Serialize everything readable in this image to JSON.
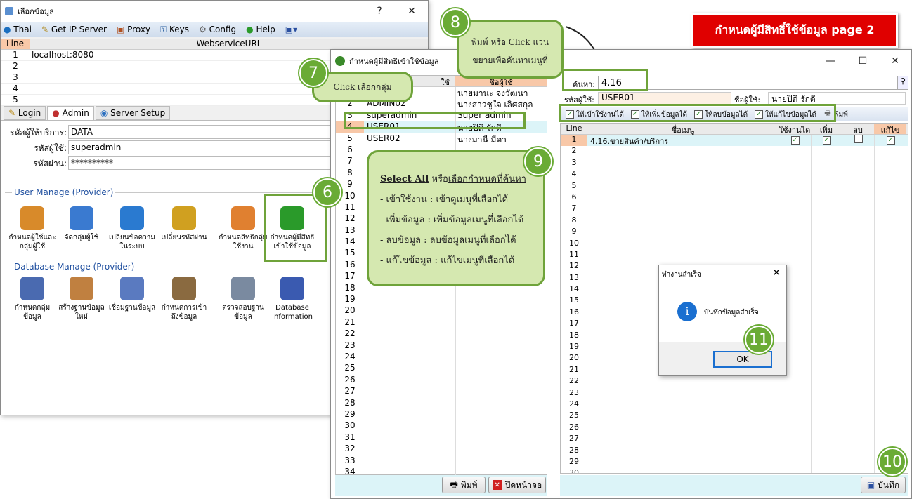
{
  "banner": {
    "text": "กำหนดผู้มีสิทธิ์ใช้ข้อมูล  page 2"
  },
  "login_window": {
    "title": "เลือกข้อมูล",
    "help_btn": "?",
    "close_btn": "✕",
    "menu": [
      "Thai",
      "Get IP Server",
      "Proxy",
      "Keys",
      "Config",
      "Help"
    ],
    "url_table": {
      "col_line": "Line",
      "col_url": "WebserviceURL",
      "rows": [
        {
          "n": "1",
          "url": "localhost:8080"
        },
        {
          "n": "2",
          "url": ""
        },
        {
          "n": "3",
          "url": ""
        },
        {
          "n": "4",
          "url": ""
        },
        {
          "n": "5",
          "url": ""
        }
      ]
    },
    "tabs": [
      "Login",
      "Admin",
      "Server Setup"
    ],
    "fields": [
      {
        "label": "รหัสผู้ให้บริการ:",
        "value": "DATA"
      },
      {
        "label": "รหัสผู้ใช้:",
        "value": "superadmin"
      },
      {
        "label": "รหัสผ่าน:",
        "value": "**********"
      }
    ],
    "user_manage_title": "User Manage (Provider)",
    "user_items": [
      "กำหนดผู้ใช้และกลุ่มผู้ใช้",
      "จัดกลุ่มผู้ใช้",
      "เปลี่ยนข้อความในระบบ",
      "เปลี่ยนรหัสผ่าน",
      "กำหนดสิทธิกลุ่มใช้งาน",
      "กำหนดผู้มีสิทธิเข้าใช้ข้อมูล"
    ],
    "db_manage_title": "Database Manage (Provider)",
    "db_items": [
      "กำหนดกลุ่มข้อมูล",
      "สร้างฐานข้อมูลใหม่",
      "เชื่อมฐานข้อมูล",
      "กำหนดการเข้าถึงข้อมูล",
      "ตรวจสอบฐานข้อมูล",
      "Database Information"
    ]
  },
  "main_window": {
    "title": "กำหนดผู้มีสิทธิเข้าใช้ข้อมูล",
    "left": {
      "header_user": "ใช้",
      "header_name": "ชื่อผู้ใช้",
      "rows": [
        {
          "n": "1",
          "user": "",
          "name": "นายมานะ จงวัฒนา"
        },
        {
          "n": "2",
          "user": "ADMIN02",
          "name": "นางสาวชูใจ เลิศสกุล"
        },
        {
          "n": "3",
          "user": "superadmin",
          "name": "Super admin"
        },
        {
          "n": "4",
          "user": "USER01",
          "name": "นายปิติ รักดี"
        },
        {
          "n": "5",
          "user": "USER02",
          "name": "นางมานี มีตา"
        }
      ],
      "row_count": 34,
      "print_btn": "พิมพ์",
      "close_btn": "ปิดหน้าจอ"
    },
    "search_label": "ค้นหา:",
    "search_value": "4.16",
    "user_code_label": "รหัสผู้ใช้:",
    "user_code_value": "USER01",
    "user_name_label": "ชื่อผู้ใช้:",
    "user_name_value": "นายปิติ รักดี",
    "toolbar": [
      "ให้เข้าใช้งานได้",
      "ให้เพิ่มข้อมูลได้",
      "ให้ลบข้อมูลได้",
      "ให้แก้ไขข้อมูลได้",
      "พิมพ์"
    ],
    "grid_headers": {
      "line": "Line",
      "menu": "ชื่อเมนู",
      "use": "ใช้งานได",
      "add": "เพิ่ม",
      "del": "ลบ",
      "edit": "แก้ไข"
    },
    "grid_rows": [
      {
        "n": "1",
        "menu": "4.16.ขายสินค้า/บริการ",
        "use": true,
        "add": true,
        "del": false,
        "edit": true
      }
    ],
    "grid_row_count": 30,
    "save_btn": "บันทึก"
  },
  "dialog": {
    "title": "ทำงานสำเร็จ",
    "message": "บันทึกข้อมูลสำเร็จ",
    "ok": "OK"
  },
  "callouts": {
    "c7": "Click เลือกกลุ่ม",
    "c8_line1": "พิมพ์ หรือ Click แว่น",
    "c8_line2": "ขยายเพื่อค้นหาเมนูที่",
    "c9_head_a": "Select All",
    "c9_head_b": " หรือ",
    "c9_head_c": "เลือกกำหนดที่ค้นหา",
    "c9_lines": [
      "- เข้าใช้งาน : เข้าดูเมนูที่เลือกได้",
      "- เพิ่มข้อมูล : เพิ่มข้อมูลเมนูที่เลือกได้",
      "- ลบข้อมูล : ลบข้อมูลเมนูที่เลือกได้",
      "- แก้ไขข้อมูล : แก้ไขเมนูที่เลือกได้"
    ]
  },
  "badges": [
    "6",
    "7",
    "8",
    "9",
    "10",
    "11"
  ]
}
